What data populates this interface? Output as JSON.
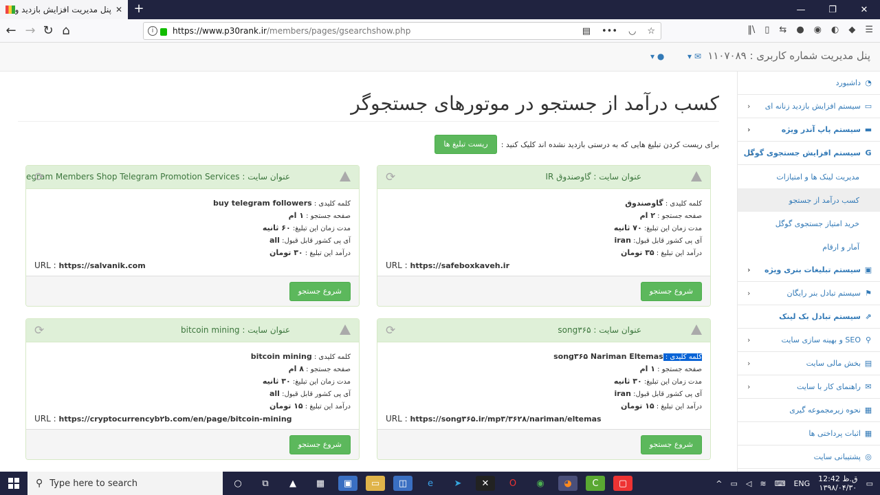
{
  "browser": {
    "tab_title": "پنل مدیریت افزایش بازدید و درآمد",
    "tab_close": "✕",
    "new_tab": "+",
    "url_host": "https://www.p30rank.ir",
    "url_path": "/members/pages/gsearchshow.php",
    "window_min": "—",
    "window_max": "❐",
    "window_close": "✕"
  },
  "header": {
    "brand": "پنل مدیریت شماره کاربری : ۱۱۰۷۰۸۹"
  },
  "sidebar": {
    "items": [
      {
        "label": "داشبورد",
        "icon": "dashboard-icon",
        "glyph": "◔",
        "bold": false,
        "arrow": false
      },
      {
        "label": "سیستم افزایش بازدید زنانه ای",
        "icon": "folder-icon",
        "glyph": "▭",
        "bold": false,
        "arrow": true
      },
      {
        "label": "سیستم پاپ آندر ویژه",
        "icon": "desktop-icon",
        "glyph": "▬",
        "bold": true,
        "arrow": true
      },
      {
        "label": "سیستم افزایش جستجوی گوگل",
        "icon": "google-icon",
        "glyph": "G",
        "bold": true,
        "arrow": true,
        "open": true
      },
      {
        "label": "مدیریت لینک ها و امتیازات",
        "sub": true
      },
      {
        "label": "کسب درآمد از جستجو",
        "sub": true,
        "active": true
      },
      {
        "label": "خرید امتیاز جستجوی گوگل",
        "sub": true
      },
      {
        "label": "آمار و ارقام",
        "sub": true
      },
      {
        "label": "سیستم تبلیغات بنری ویژه",
        "icon": "image-icon",
        "glyph": "▣",
        "bold": true,
        "arrow": true
      },
      {
        "label": "سیستم تبادل بنر رایگان",
        "icon": "flag-icon",
        "glyph": "⚑",
        "bold": false,
        "arrow": true
      },
      {
        "label": "سیستم تبادل بک لینک",
        "icon": "external-link-icon",
        "glyph": "⇗",
        "bold": true,
        "arrow": false
      },
      {
        "label": "SEO و بهینه سازی سایت",
        "icon": "search-icon",
        "glyph": "⚲",
        "bold": false,
        "arrow": true
      },
      {
        "label": "بخش مالی سایت",
        "icon": "money-icon",
        "glyph": "▤",
        "bold": false,
        "arrow": true
      },
      {
        "label": "راهنمای کار با سایت",
        "icon": "comments-icon",
        "glyph": "✉",
        "bold": false,
        "arrow": true
      },
      {
        "label": "نحوه زیرمجموعه گیری",
        "icon": "table-icon",
        "glyph": "▦",
        "bold": false,
        "arrow": false
      },
      {
        "label": "اثبات پرداختی ها",
        "icon": "table-icon",
        "glyph": "▦",
        "bold": false,
        "arrow": false
      },
      {
        "label": "پشتیبانی سایت",
        "icon": "support-icon",
        "glyph": "◎",
        "bold": false,
        "arrow": false
      }
    ]
  },
  "main": {
    "title": "کسب درآمد از جستجو در موتورهای جستجوگر",
    "reset_text": "برای ریست کردن تبلیغ هایی که به درستی بازدید نشده اند کلیک کنید :",
    "reset_button": "ریست تبلیغ ها",
    "labels": {
      "site_title": "عنوان سایت : ",
      "keyword": "کلمه کلیدی : ",
      "page": "صفحه جستجو : ",
      "duration": "مدت زمان این تبلیغ: ",
      "country": "آی پی کشور قابل قبول: ",
      "income": "درآمد این تبلیغ : ",
      "url": "URL : ",
      "start_button": "شروع جستجو"
    },
    "cards": [
      {
        "title": "گاوصندوق IR",
        "keyword": "گاوصندوق",
        "page": "۲ ام",
        "duration": "۷۰ ثانیه",
        "country": "iran",
        "income": "۳۵ تومان",
        "url": "https://safeboxkaveh.ir"
      },
      {
        "title": "Buy Telegram Members Shop Telegram Promotion Services",
        "keyword": "buy telegram followers",
        "page": "۱ ام",
        "duration": "۶۰ ثانیه",
        "country": "all",
        "income": "۳۰ تومان",
        "url": "https://salvanik.com"
      },
      {
        "title": "song۳۶۵",
        "keyword": "song۳۶۵ Nariman Eltemas",
        "page": "۱ ام",
        "duration": "۳۰ ثانیه",
        "country": "iran",
        "income": "۱۵ تومان",
        "url": "https://song۳۶۵.ir/mp۳/۳۶۲۸/nariman/eltemas"
      },
      {
        "title": "bitcoin mining",
        "keyword": "bitcoin mining",
        "page": "۸ ام",
        "duration": "۳۰ ثانیه",
        "country": "all",
        "income": "۱۵ تومان",
        "url": "https://cryptocurrencyb۲b.com/en/page/bitcoin-mining"
      }
    ]
  },
  "taskbar": {
    "search_placeholder": "Type here to search",
    "lang": "ENG",
    "time": "12:42 ق.ظ",
    "date": "۱۳۹۸/۰۴/۳۰"
  }
}
